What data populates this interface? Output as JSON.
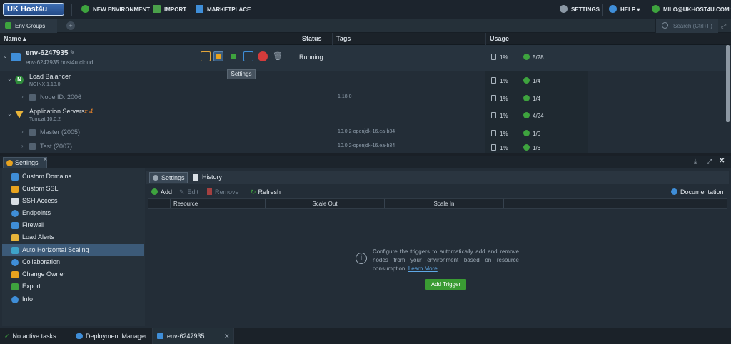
{
  "topbar": {
    "logo": "UK Host4u",
    "new_environment": "NEW ENVIRONMENT",
    "import": "IMPORT",
    "marketplace": "MARKETPLACE",
    "settings": "SETTINGS",
    "help": "HELP",
    "user": "MILO@UKHOST4U.COM"
  },
  "breadcrumb": {
    "env_groups": "Env Groups",
    "search_placeholder": "Search (Ctrl+F)"
  },
  "table": {
    "columns": {
      "name": "Name",
      "status": "Status",
      "tags": "Tags",
      "usage": "Usage"
    },
    "env": {
      "name": "env-6247935",
      "domain": "env-6247935.host4u.cloud",
      "status": "Running",
      "usage_pct": "1%",
      "cloudlets": "5/28"
    },
    "tooltip": "Settings",
    "rows": [
      {
        "name": "Load Balancer",
        "sub": "NGINX 1.18.0",
        "usage_pct": "1%",
        "cloudlets": "1/4"
      },
      {
        "name": "Node ID: 2006",
        "tag": "1.18.0",
        "usage_pct": "1%",
        "cloudlets": "1/4"
      },
      {
        "name": "Application Servers",
        "count": "x 4",
        "sub": "Tomcat 10.0.2",
        "usage_pct": "1%",
        "cloudlets": "4/24"
      },
      {
        "name": "Master (2005)",
        "tag": "10.0.2-openjdk-16.ea-b34",
        "usage_pct": "1%",
        "cloudlets": "1/6"
      },
      {
        "name": "Test (2007)",
        "tag": "10.0.2-openjdk-16.ea-b34",
        "usage_pct": "1%",
        "cloudlets": "1/6"
      }
    ]
  },
  "panel": {
    "tab": "Settings",
    "nav": [
      "Custom Domains",
      "Custom SSL",
      "SSH Access",
      "Endpoints",
      "Firewall",
      "Load Alerts",
      "Auto Horizontal Scaling",
      "Collaboration",
      "Change Owner",
      "Export",
      "Info"
    ],
    "subtabs": {
      "settings": "Settings",
      "history": "History"
    },
    "toolbar": {
      "add": "Add",
      "edit": "Edit",
      "remove": "Remove",
      "refresh": "Refresh",
      "documentation": "Documentation"
    },
    "grid": {
      "resource": "Resource",
      "scale_out": "Scale Out",
      "scale_in": "Scale In"
    },
    "empty": {
      "text": "Configure the triggers to automatically add and remove nodes from your environment based on resource consumption.",
      "link": "Learn More",
      "button": "Add Trigger"
    }
  },
  "statusbar": {
    "tasks": "No active tasks",
    "deployment": "Deployment Manager",
    "env_tab": "env-6247935"
  },
  "colors": {
    "accent_green": "#3a9b33",
    "active_blue": "#3c5a78",
    "warn_orange": "#e8832a",
    "link_blue": "#5fa8e6"
  }
}
